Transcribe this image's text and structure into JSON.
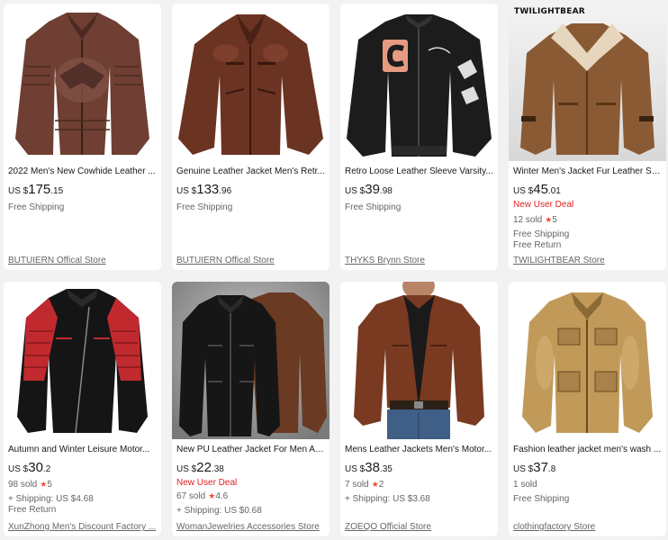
{
  "products": [
    {
      "title": "2022 Men's New Cowhide Leather ...",
      "currency": "US $",
      "price_int": "175",
      "price_dec": ".15",
      "deal": "",
      "sold": "",
      "rating": "",
      "shipping": [
        "Free Shipping"
      ],
      "store": "BUTUIERN Offical Store",
      "image": "distressed brown leather jacket with embossed eagle"
    },
    {
      "title": "Genuine Leather Jacket Men's Retr...",
      "currency": "US $",
      "price_int": "133",
      "price_dec": ".96",
      "deal": "",
      "sold": "",
      "rating": "",
      "shipping": [
        "Free Shipping"
      ],
      "store": "BUTUIERN Offical Store",
      "image": "brown leather jacket"
    },
    {
      "title": "Retro Loose Leather Sleeve Varsity...",
      "currency": "US $",
      "price_int": "39",
      "price_dec": ".98",
      "deal": "",
      "sold": "",
      "rating": "",
      "shipping": [
        "Free Shipping"
      ],
      "store": "THYKS Brynn Store",
      "image": "black varsity jacket with C patch"
    },
    {
      "title": "Winter Men's Jacket Fur Leather Su...",
      "currency": "US $",
      "price_int": "45",
      "price_dec": ".01",
      "deal": "New User Deal",
      "sold": "12 sold",
      "rating": "5",
      "shipping": [
        "Free Shipping",
        "Free Return"
      ],
      "store": "TWILIGHTBEAR Store",
      "brand_mark": "TWILIGHTBEAR",
      "image": "tan suede jacket with fur collar"
    },
    {
      "title": "Autumn and Winter Leisure Motor...",
      "currency": "US $",
      "price_int": "30",
      "price_dec": ".2",
      "deal": "",
      "sold": "98 sold",
      "rating": "5",
      "shipping": [
        "+ Shipping: US $4.68",
        "Free Return"
      ],
      "store": "XunZhong Men's Discount Factory ...",
      "image": "black and red motorcycle leather jacket"
    },
    {
      "title": "New PU Leather Jacket For Men Au...",
      "currency": "US $",
      "price_int": "22",
      "price_dec": ".38",
      "deal": "New User Deal",
      "sold": "67 sold",
      "rating": "4.6",
      "shipping": [
        "+ Shipping: US $0.68"
      ],
      "store": "WomanJewelries Accessories Store",
      "image": "black and brown PU leather jackets"
    },
    {
      "title": "Mens Leather Jackets Men's Motor...",
      "currency": "US $",
      "price_int": "38",
      "price_dec": ".35",
      "deal": "",
      "sold": "7 sold",
      "rating": "2",
      "shipping": [
        "+ Shipping: US $3.68"
      ],
      "store": "ZOEQO Official Store",
      "image": "man wearing brown leather jacket"
    },
    {
      "title": "Fashion leather jacket men's wash ...",
      "currency": "US $",
      "price_int": "37",
      "price_dec": ".8",
      "deal": "",
      "sold": "1 sold",
      "rating": "",
      "shipping": [
        "Free Shipping"
      ],
      "store": "clothingfactory Store",
      "image": "tan washed leather jacket"
    }
  ],
  "colors": {
    "background": "#f2f2f2",
    "card": "#ffffff",
    "deal_red": "#e02020",
    "star_red": "#f04a3a",
    "muted": "#666666"
  },
  "icons": {
    "rating": "star-icon"
  }
}
